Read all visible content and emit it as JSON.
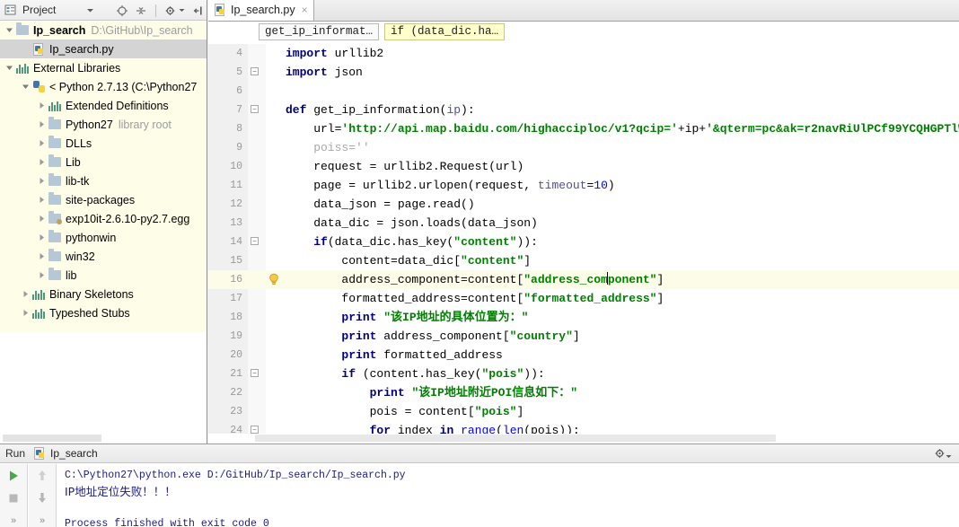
{
  "project_panel": {
    "title": "Project",
    "icons": [
      "project-dropdown-icon",
      "locate-icon",
      "collapse-all-icon",
      "settings-icon",
      "hide-icon"
    ],
    "tree": [
      {
        "indent": 0,
        "arrow": "down",
        "icon": "folder-icon",
        "label": "Ip_search",
        "sub": "D:\\GitHub\\Ip_search",
        "bold": true,
        "selected": false
      },
      {
        "indent": 1,
        "arrow": "none",
        "icon": "python-file-icon",
        "label": "Ip_search.py",
        "sub": "",
        "bold": false,
        "selected": true
      },
      {
        "indent": 0,
        "arrow": "down",
        "icon": "library-icon",
        "label": "External Libraries",
        "sub": "",
        "bold": false,
        "selected": false
      },
      {
        "indent": 1,
        "arrow": "down",
        "icon": "python-icon",
        "label": "< Python 2.7.13 (C:\\Python27",
        "sub": "",
        "bold": false,
        "selected": false
      },
      {
        "indent": 2,
        "arrow": "right",
        "icon": "library-icon",
        "label": "Extended Definitions",
        "sub": "",
        "bold": false,
        "selected": false
      },
      {
        "indent": 2,
        "arrow": "right",
        "icon": "folder-icon",
        "label": "Python27",
        "sub": "library root",
        "bold": false,
        "selected": false
      },
      {
        "indent": 2,
        "arrow": "right",
        "icon": "folder-icon",
        "label": "DLLs",
        "sub": "",
        "bold": false,
        "selected": false
      },
      {
        "indent": 2,
        "arrow": "right",
        "icon": "folder-icon",
        "label": "Lib",
        "sub": "",
        "bold": false,
        "selected": false
      },
      {
        "indent": 2,
        "arrow": "right",
        "icon": "folder-icon",
        "label": "lib-tk",
        "sub": "",
        "bold": false,
        "selected": false
      },
      {
        "indent": 2,
        "arrow": "right",
        "icon": "folder-icon",
        "label": "site-packages",
        "sub": "",
        "bold": false,
        "selected": false
      },
      {
        "indent": 2,
        "arrow": "right",
        "icon": "egg-icon",
        "label": "exp10it-2.6.10-py2.7.egg",
        "sub": "",
        "bold": false,
        "selected": false
      },
      {
        "indent": 2,
        "arrow": "right",
        "icon": "folder-icon",
        "label": "pythonwin",
        "sub": "",
        "bold": false,
        "selected": false
      },
      {
        "indent": 2,
        "arrow": "right",
        "icon": "folder-icon",
        "label": "win32",
        "sub": "",
        "bold": false,
        "selected": false
      },
      {
        "indent": 2,
        "arrow": "right",
        "icon": "folder-icon",
        "label": "lib",
        "sub": "",
        "bold": false,
        "selected": false
      },
      {
        "indent": 1,
        "arrow": "right",
        "icon": "library-icon",
        "label": "Binary Skeletons",
        "sub": "",
        "bold": false,
        "selected": false
      },
      {
        "indent": 1,
        "arrow": "right",
        "icon": "library-icon",
        "label": "Typeshed Stubs",
        "sub": "",
        "bold": false,
        "selected": false
      }
    ]
  },
  "editor": {
    "tab": {
      "label": "Ip_search.py",
      "icon": "python-file-icon",
      "close": "×"
    },
    "breadcrumbs": [
      {
        "label": "get_ip_informat…",
        "highlighted": false
      },
      {
        "label": "if (data_dic.ha…",
        "highlighted": true
      }
    ],
    "lines": [
      {
        "num": "4",
        "fold": "",
        "bulb": false,
        "hl": false,
        "tokens": [
          {
            "t": "import",
            "c": "kw"
          },
          {
            "t": " urllib2",
            "c": ""
          }
        ]
      },
      {
        "num": "5",
        "fold": "minus-top",
        "bulb": false,
        "hl": false,
        "tokens": [
          {
            "t": "import",
            "c": "kw"
          },
          {
            "t": " json",
            "c": ""
          }
        ]
      },
      {
        "num": "6",
        "fold": "",
        "bulb": false,
        "hl": false,
        "tokens": []
      },
      {
        "num": "7",
        "fold": "minus",
        "bulb": false,
        "hl": false,
        "tokens": [
          {
            "t": "def",
            "c": "kw"
          },
          {
            "t": " get_ip_information(",
            "c": ""
          },
          {
            "t": "ip",
            "c": "param"
          },
          {
            "t": "):",
            "c": ""
          }
        ]
      },
      {
        "num": "8",
        "fold": "",
        "bulb": false,
        "hl": false,
        "tokens": [
          {
            "t": "    url=",
            "c": ""
          },
          {
            "t": "'http://api.map.baidu.com/highacciploc/v1?qcip='",
            "c": "str"
          },
          {
            "t": "+ip+",
            "c": ""
          },
          {
            "t": "'&qterm=pc&ak=r2navRiUlPCf99YCQHGPTlW",
            "c": "str"
          }
        ]
      },
      {
        "num": "9",
        "fold": "",
        "bulb": false,
        "hl": false,
        "tokens": [
          {
            "t": "    poiss=",
            "c": "gray"
          },
          {
            "t": "''",
            "c": "gray"
          }
        ]
      },
      {
        "num": "10",
        "fold": "",
        "bulb": false,
        "hl": false,
        "tokens": [
          {
            "t": "    request = urllib2.Request(url)",
            "c": ""
          }
        ]
      },
      {
        "num": "11",
        "fold": "",
        "bulb": false,
        "hl": false,
        "tokens": [
          {
            "t": "    page = urllib2.urlopen(request, ",
            "c": ""
          },
          {
            "t": "timeout",
            "c": "param"
          },
          {
            "t": "=",
            "c": ""
          },
          {
            "t": "10",
            "c": "num"
          },
          {
            "t": ")",
            "c": ""
          }
        ]
      },
      {
        "num": "12",
        "fold": "",
        "bulb": false,
        "hl": false,
        "tokens": [
          {
            "t": "    data_json = page.read()",
            "c": ""
          }
        ]
      },
      {
        "num": "13",
        "fold": "",
        "bulb": false,
        "hl": false,
        "tokens": [
          {
            "t": "    data_dic = json.loads(data_json)",
            "c": ""
          }
        ]
      },
      {
        "num": "14",
        "fold": "minus",
        "bulb": false,
        "hl": false,
        "tokens": [
          {
            "t": "    ",
            "c": ""
          },
          {
            "t": "if",
            "c": "kw"
          },
          {
            "t": "(data_dic.has_key(",
            "c": ""
          },
          {
            "t": "\"content\"",
            "c": "str"
          },
          {
            "t": ")):",
            "c": ""
          }
        ]
      },
      {
        "num": "15",
        "fold": "",
        "bulb": false,
        "hl": false,
        "tokens": [
          {
            "t": "        content=data_dic[",
            "c": ""
          },
          {
            "t": "\"content\"",
            "c": "str"
          },
          {
            "t": "]",
            "c": ""
          }
        ]
      },
      {
        "num": "16",
        "fold": "",
        "bulb": true,
        "hl": true,
        "tokens": [
          {
            "t": "        address_component=content[",
            "c": ""
          },
          {
            "t": "\"address_com",
            "c": "str"
          },
          {
            "t": "|CURSOR|",
            "c": "cursor"
          },
          {
            "t": "ponent\"",
            "c": "str"
          },
          {
            "t": "]",
            "c": ""
          }
        ]
      },
      {
        "num": "17",
        "fold": "",
        "bulb": false,
        "hl": false,
        "tokens": [
          {
            "t": "        formatted_address=content[",
            "c": ""
          },
          {
            "t": "\"formatted_address\"",
            "c": "str"
          },
          {
            "t": "]",
            "c": ""
          }
        ]
      },
      {
        "num": "18",
        "fold": "",
        "bulb": false,
        "hl": false,
        "tokens": [
          {
            "t": "        ",
            "c": ""
          },
          {
            "t": "print",
            "c": "kw"
          },
          {
            "t": " ",
            "c": ""
          },
          {
            "t": "\"该IP地址的具体位置为：\"",
            "c": "str"
          }
        ]
      },
      {
        "num": "19",
        "fold": "",
        "bulb": false,
        "hl": false,
        "tokens": [
          {
            "t": "        ",
            "c": ""
          },
          {
            "t": "print",
            "c": "kw"
          },
          {
            "t": " address_component[",
            "c": ""
          },
          {
            "t": "\"country\"",
            "c": "str"
          },
          {
            "t": "]",
            "c": ""
          }
        ]
      },
      {
        "num": "20",
        "fold": "",
        "bulb": false,
        "hl": false,
        "tokens": [
          {
            "t": "        ",
            "c": ""
          },
          {
            "t": "print",
            "c": "kw"
          },
          {
            "t": " formatted_address",
            "c": ""
          }
        ]
      },
      {
        "num": "21",
        "fold": "minus",
        "bulb": false,
        "hl": false,
        "tokens": [
          {
            "t": "        ",
            "c": ""
          },
          {
            "t": "if",
            "c": "kw"
          },
          {
            "t": " (content.has_key(",
            "c": ""
          },
          {
            "t": "\"pois\"",
            "c": "str"
          },
          {
            "t": ")):",
            "c": ""
          }
        ]
      },
      {
        "num": "22",
        "fold": "",
        "bulb": false,
        "hl": false,
        "tokens": [
          {
            "t": "            ",
            "c": ""
          },
          {
            "t": "print",
            "c": "kw"
          },
          {
            "t": " ",
            "c": ""
          },
          {
            "t": "\"该IP地址附近POI信息如下：\"",
            "c": "str"
          }
        ]
      },
      {
        "num": "23",
        "fold": "",
        "bulb": false,
        "hl": false,
        "tokens": [
          {
            "t": "            pois = content[",
            "c": ""
          },
          {
            "t": "\"pois\"",
            "c": "str"
          },
          {
            "t": "]",
            "c": ""
          }
        ]
      },
      {
        "num": "24",
        "fold": "minus",
        "bulb": false,
        "hl": false,
        "tokens": [
          {
            "t": "            ",
            "c": ""
          },
          {
            "t": "for",
            "c": "kw"
          },
          {
            "t": " index ",
            "c": ""
          },
          {
            "t": "in",
            "c": "kw"
          },
          {
            "t": " ",
            "c": ""
          },
          {
            "t": "range",
            "c": "num"
          },
          {
            "t": "(",
            "c": ""
          },
          {
            "t": "len",
            "c": "num"
          },
          {
            "t": "(pois)):",
            "c": ""
          }
        ]
      }
    ]
  },
  "run_panel": {
    "title": "Run",
    "tab_label": "Ip_search",
    "tab_icon": "python-file-icon",
    "settings_icon": "gear-icon",
    "left_buttons": [
      "run-icon",
      "stop-icon",
      "expand-icon"
    ],
    "second_buttons": [
      "up-arrow-icon",
      "down-arrow-icon",
      "expand-icon"
    ],
    "console_lines": [
      {
        "text": "C:\\Python27\\python.exe D:/GitHub/Ip_search/Ip_search.py",
        "cn": false
      },
      {
        "text": "IP地址定位失败！！！",
        "cn": true
      },
      {
        "text": "",
        "cn": false
      },
      {
        "text": "Process finished with exit code 0",
        "cn": false
      }
    ]
  },
  "colors": {
    "tree_bg": "#fdfde8",
    "selection": "#d4d4d4",
    "highlight_line": "#fdfce8",
    "keyword": "#000080",
    "string": "#008000",
    "number": "#0000ff",
    "console_text": "#1a1a8a",
    "run_green": "#4aa84a"
  }
}
